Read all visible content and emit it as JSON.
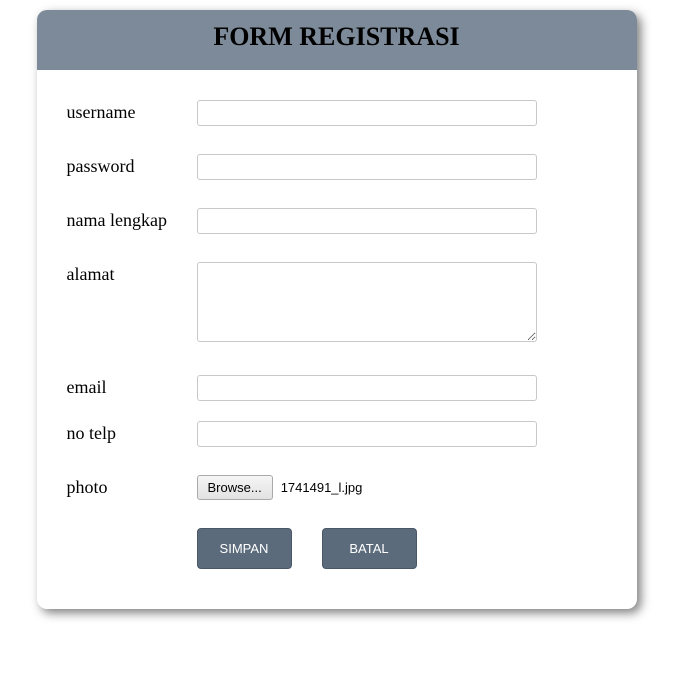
{
  "header": {
    "title": "FORM REGISTRASI"
  },
  "fields": {
    "username": {
      "label": "username",
      "value": ""
    },
    "password": {
      "label": "password",
      "value": ""
    },
    "nama_lengkap": {
      "label": "nama lengkap",
      "value": ""
    },
    "alamat": {
      "label": "alamat",
      "value": ""
    },
    "email": {
      "label": "email",
      "value": ""
    },
    "no_telp": {
      "label": "no telp",
      "value": ""
    },
    "photo": {
      "label": "photo",
      "browse_label": "Browse...",
      "filename": "1741491_l.jpg"
    }
  },
  "actions": {
    "save": "SIMPAN",
    "cancel": "BATAL"
  }
}
